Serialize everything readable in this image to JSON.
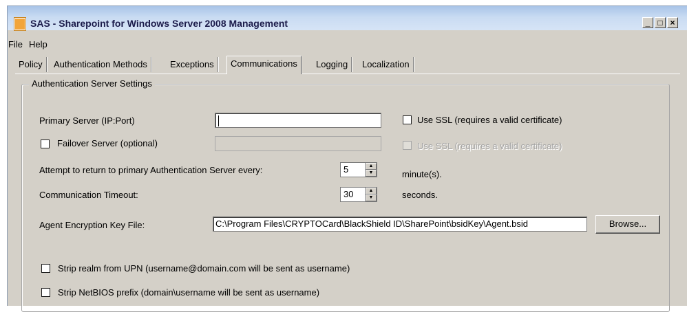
{
  "window": {
    "title": "SAS - Sharepoint for Windows Server 2008 Management",
    "controls": {
      "minimize": "_",
      "maximize": "□",
      "close": "×"
    }
  },
  "menu": {
    "items": [
      "File",
      "Help"
    ]
  },
  "tabs": [
    "Policy",
    "Authentication Methods",
    "Exceptions",
    "Communications",
    "Logging",
    "Localization"
  ],
  "active_tab": "Communications",
  "group": {
    "title": "Authentication Server Settings",
    "primary_server": {
      "label": "Primary Server (IP:Port)",
      "value": ""
    },
    "primary_ssl": {
      "label": "Use SSL (requires a valid certificate)",
      "checked": false
    },
    "failover": {
      "label": "Failover Server (optional)",
      "checked": false,
      "value": ""
    },
    "failover_ssl": {
      "label": "Use SSL (requires a valid certificate)",
      "checked": false,
      "disabled": true
    },
    "retry": {
      "label": "Attempt to return to primary Authentication Server every:",
      "value": "5",
      "unit": "minute(s)."
    },
    "timeout": {
      "label": "Communication Timeout:",
      "value": "30",
      "unit": "seconds."
    },
    "key_file": {
      "label": "Agent Encryption Key File:",
      "value": "C:\\Program Files\\CRYPTOCard\\BlackShield ID\\SharePoint\\bsidKey\\Agent.bsid",
      "browse": "Browse..."
    },
    "strip_realm": {
      "label": "Strip realm from UPN (username@domain.com will be sent as username)",
      "checked": false
    },
    "strip_netbios": {
      "label": "Strip NetBIOS prefix (domain\\username will be sent as username)",
      "checked": false
    }
  },
  "icons": {
    "app": "app-icon",
    "spin_up": "spin-up-arrow-icon",
    "spin_down": "spin-down-arrow-icon"
  }
}
